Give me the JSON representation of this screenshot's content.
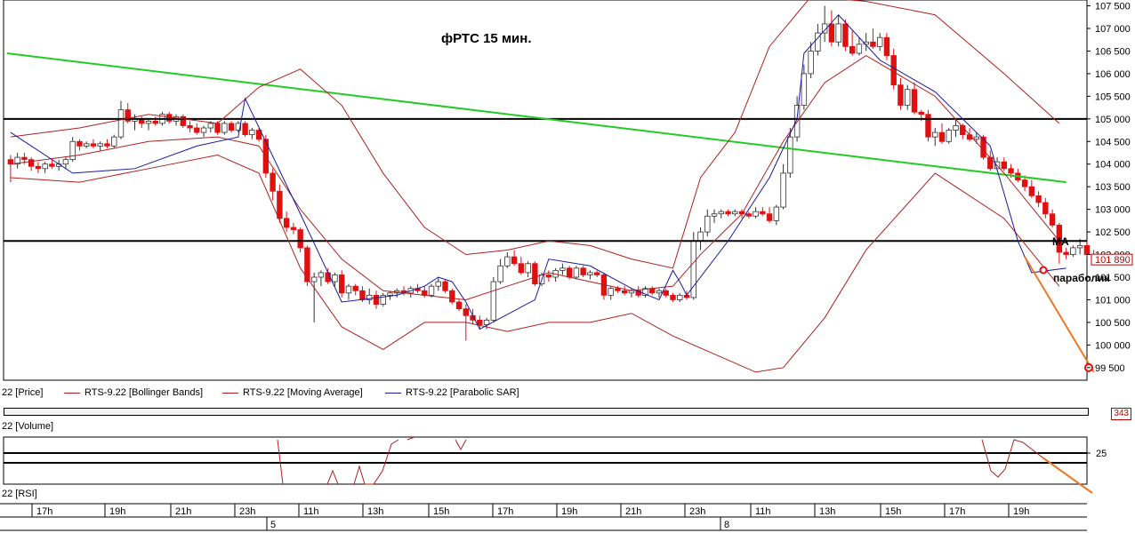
{
  "title": "фРТС   15 мин.",
  "annotations": {
    "ma": "MA",
    "parabolic": "параболик"
  },
  "price_axis": {
    "ticks": [
      "107 500",
      "107 000",
      "106 500",
      "106 000",
      "105 500",
      "105 000",
      "104 500",
      "104 000",
      "103 500",
      "103 000",
      "102 500",
      "102 000",
      "101 500",
      "101 000",
      "100 500",
      "100 000",
      "99 500"
    ],
    "current_price": "101 890",
    "low_marker": "99 500"
  },
  "legend": [
    {
      "label": "22 [Price]",
      "color": ""
    },
    {
      "label": "RTS-9.22 [Bollinger Bands]",
      "color": "#b02020"
    },
    {
      "label": "RTS-9.22 [Moving Average]",
      "color": "#b02020"
    },
    {
      "label": "RTS-9.22 [Parabolic SAR]",
      "color": "#1a1aa0"
    }
  ],
  "volume_pane": {
    "label": "22 [Volume]",
    "badge": "343"
  },
  "rsi_pane": {
    "label": "22 [RSI]",
    "tick": "25"
  },
  "time_axis": {
    "hours": [
      "17h",
      "19h",
      "21h",
      "23h",
      "11h",
      "13h",
      "15h",
      "17h",
      "19h",
      "21h",
      "23h",
      "11h",
      "13h",
      "15h",
      "17h",
      "19h"
    ],
    "days": [
      "5",
      "8"
    ]
  },
  "colors": {
    "up": "#ffffff",
    "down": "#e01010",
    "bollinger": "#b02020",
    "sar": "#1a1aa0",
    "trend": "#22cc22",
    "level": "#000000",
    "forecast": "#ee7722"
  },
  "chart_data": {
    "type": "candlestick",
    "title": "фРТС   15 мин.",
    "ylim": [
      99300,
      107550
    ],
    "levels": [
      105000,
      102300
    ],
    "trendline": [
      [
        0,
        106450
      ],
      [
        153,
        103600
      ]
    ],
    "candles": [
      [
        104100,
        104200,
        103600,
        104000
      ],
      [
        104000,
        104250,
        103900,
        104150
      ],
      [
        104150,
        104250,
        104000,
        104100
      ],
      [
        104100,
        104150,
        103850,
        103950
      ],
      [
        103950,
        104050,
        103800,
        103900
      ],
      [
        103900,
        104050,
        103800,
        104000
      ],
      [
        104000,
        104100,
        103900,
        103950
      ],
      [
        103950,
        104100,
        103850,
        104000
      ],
      [
        104000,
        104150,
        103900,
        104100
      ],
      [
        104100,
        104600,
        104050,
        104500
      ],
      [
        104500,
        104550,
        104300,
        104400
      ],
      [
        104400,
        104500,
        104350,
        104450
      ],
      [
        104450,
        104550,
        104350,
        104400
      ],
      [
        104400,
        104500,
        104300,
        104450
      ],
      [
        104450,
        104550,
        104350,
        104400
      ],
      [
        104400,
        104650,
        104350,
        104600
      ],
      [
        104600,
        105400,
        104550,
        105200
      ],
      [
        105200,
        105350,
        104900,
        104950
      ],
      [
        104950,
        105100,
        104750,
        105000
      ],
      [
        105000,
        105050,
        104800,
        104900
      ],
      [
        104900,
        105000,
        104750,
        104950
      ],
      [
        104950,
        105050,
        104850,
        104900
      ],
      [
        104900,
        105150,
        104850,
        105100
      ],
      [
        105100,
        105150,
        104900,
        104950
      ],
      [
        104950,
        105100,
        104850,
        105050
      ],
      [
        105050,
        105100,
        104800,
        104850
      ],
      [
        104850,
        104950,
        104700,
        104800
      ],
      [
        104800,
        104900,
        104650,
        104700
      ],
      [
        104700,
        104850,
        104600,
        104800
      ],
      [
        104800,
        104950,
        104700,
        104900
      ],
      [
        104900,
        104950,
        104650,
        104700
      ],
      [
        104700,
        104950,
        104650,
        104900
      ],
      [
        104900,
        104950,
        104700,
        104750
      ],
      [
        104750,
        104950,
        104700,
        104900
      ],
      [
        104900,
        104950,
        104600,
        104650
      ],
      [
        104650,
        104800,
        104550,
        104750
      ],
      [
        104750,
        104800,
        104500,
        104550
      ],
      [
        104550,
        104650,
        103700,
        103800
      ],
      [
        103800,
        103900,
        103200,
        103400
      ],
      [
        103400,
        103550,
        102700,
        102800
      ],
      [
        102800,
        102950,
        102500,
        102600
      ],
      [
        102600,
        102700,
        102450,
        102550
      ],
      [
        102550,
        102600,
        102050,
        102150
      ],
      [
        102150,
        102200,
        101300,
        101400
      ],
      [
        101400,
        101600,
        100500,
        101500
      ],
      [
        101500,
        101650,
        101300,
        101600
      ],
      [
        101600,
        101700,
        101350,
        101400
      ],
      [
        101400,
        101600,
        101300,
        101550
      ],
      [
        101550,
        101650,
        101050,
        101150
      ],
      [
        101150,
        101350,
        101000,
        101300
      ],
      [
        101300,
        101350,
        101100,
        101200
      ],
      [
        101200,
        101300,
        100950,
        101000
      ],
      [
        101000,
        101250,
        100900,
        101100
      ],
      [
        101100,
        101200,
        100800,
        100900
      ],
      [
        100900,
        101150,
        100850,
        101100
      ],
      [
        101100,
        101200,
        101000,
        101150
      ],
      [
        101150,
        101250,
        101050,
        101200
      ],
      [
        101200,
        101300,
        101100,
        101150
      ],
      [
        101150,
        101300,
        101050,
        101250
      ],
      [
        101250,
        101350,
        101150,
        101200
      ],
      [
        101200,
        101300,
        101050,
        101100
      ],
      [
        101100,
        101350,
        101050,
        101300
      ],
      [
        101300,
        101500,
        101200,
        101400
      ],
      [
        101400,
        101450,
        101150,
        101200
      ],
      [
        101200,
        101250,
        100900,
        100950
      ],
      [
        100950,
        101000,
        100750,
        100800
      ],
      [
        100800,
        100900,
        100100,
        100650
      ],
      [
        100650,
        100800,
        100450,
        100550
      ],
      [
        100550,
        100650,
        100350,
        100450
      ],
      [
        100450,
        100600,
        100350,
        100550
      ],
      [
        100550,
        101500,
        100500,
        101400
      ],
      [
        101400,
        101900,
        101350,
        101750
      ],
      [
        101750,
        102050,
        101700,
        101950
      ],
      [
        101950,
        102100,
        101750,
        101800
      ],
      [
        101800,
        101950,
        101550,
        101600
      ],
      [
        101600,
        101850,
        101500,
        101800
      ],
      [
        101800,
        101850,
        101300,
        101350
      ],
      [
        101350,
        101600,
        101300,
        101550
      ],
      [
        101550,
        101650,
        101400,
        101500
      ],
      [
        101500,
        101700,
        101400,
        101650
      ],
      [
        101650,
        101800,
        101550,
        101700
      ],
      [
        101700,
        101750,
        101450,
        101500
      ],
      [
        101500,
        101750,
        101450,
        101700
      ],
      [
        101700,
        101750,
        101500,
        101550
      ],
      [
        101550,
        101650,
        101450,
        101600
      ],
      [
        101600,
        101650,
        101500,
        101550
      ],
      [
        101550,
        101600,
        101000,
        101100
      ],
      [
        101100,
        101300,
        101000,
        101250
      ],
      [
        101250,
        101300,
        101150,
        101200
      ],
      [
        101200,
        101300,
        101100,
        101150
      ],
      [
        101150,
        101250,
        101050,
        101200
      ],
      [
        101200,
        101300,
        101050,
        101100
      ],
      [
        101100,
        101300,
        101050,
        101250
      ],
      [
        101250,
        101300,
        101100,
        101150
      ],
      [
        101150,
        101250,
        101050,
        101200
      ],
      [
        101200,
        101250,
        101050,
        101100
      ],
      [
        101100,
        101150,
        100950,
        101000
      ],
      [
        101000,
        101150,
        100950,
        101100
      ],
      [
        101100,
        101200,
        101000,
        101050
      ],
      [
        101050,
        102500,
        101000,
        102300
      ],
      [
        102300,
        102600,
        102100,
        102500
      ],
      [
        102500,
        103000,
        102400,
        102850
      ],
      [
        102850,
        103000,
        102700,
        102900
      ],
      [
        102900,
        103000,
        102800,
        102950
      ],
      [
        102950,
        103000,
        102850,
        102900
      ],
      [
        102900,
        103000,
        102850,
        102950
      ],
      [
        102950,
        103000,
        102800,
        102900
      ],
      [
        102900,
        102950,
        102800,
        102850
      ],
      [
        102850,
        103050,
        102800,
        102950
      ],
      [
        102950,
        103050,
        102850,
        102900
      ],
      [
        102900,
        103050,
        102700,
        102750
      ],
      [
        102750,
        103100,
        102650,
        103050
      ],
      [
        103050,
        104000,
        103000,
        103800
      ],
      [
        103800,
        104800,
        103700,
        104600
      ],
      [
        104600,
        105500,
        104500,
        105300
      ],
      [
        105300,
        106200,
        105200,
        106000
      ],
      [
        106000,
        106700,
        105900,
        106500
      ],
      [
        106500,
        107100,
        106400,
        106900
      ],
      [
        106900,
        107500,
        106700,
        107100
      ],
      [
        107100,
        107400,
        106600,
        106700
      ],
      [
        106700,
        107300,
        106600,
        107100
      ],
      [
        107100,
        107200,
        106500,
        106600
      ],
      [
        106600,
        106950,
        106400,
        106450
      ],
      [
        106450,
        106800,
        106400,
        106650
      ],
      [
        106650,
        106900,
        106500,
        106700
      ],
      [
        106700,
        107000,
        106550,
        106600
      ],
      [
        106600,
        106900,
        106500,
        106800
      ],
      [
        106800,
        106900,
        106300,
        106400
      ],
      [
        106400,
        106550,
        105650,
        105750
      ],
      [
        105750,
        105900,
        105200,
        105300
      ],
      [
        105300,
        105750,
        105200,
        105650
      ],
      [
        105650,
        105800,
        105100,
        105150
      ],
      [
        105150,
        105200,
        104950,
        105100
      ],
      [
        105100,
        105200,
        104500,
        104600
      ],
      [
        104600,
        104800,
        104400,
        104700
      ],
      [
        104700,
        104900,
        104450,
        104500
      ],
      [
        104500,
        104800,
        104450,
        104750
      ],
      [
        104750,
        105000,
        104600,
        104850
      ],
      [
        104850,
        104900,
        104550,
        104650
      ],
      [
        104650,
        104800,
        104500,
        104550
      ],
      [
        104550,
        104700,
        104450,
        104600
      ],
      [
        104600,
        104650,
        104100,
        104150
      ],
      [
        104150,
        104300,
        103850,
        103900
      ],
      [
        103900,
        104150,
        103850,
        104050
      ],
      [
        104050,
        104150,
        103850,
        103900
      ],
      [
        103900,
        104000,
        103700,
        103800
      ],
      [
        103800,
        103900,
        103600,
        103650
      ],
      [
        103650,
        103750,
        103400,
        103500
      ],
      [
        103500,
        103650,
        103250,
        103300
      ],
      [
        103300,
        103400,
        103050,
        103150
      ],
      [
        103150,
        103250,
        102800,
        102900
      ],
      [
        102900,
        103000,
        102600,
        102650
      ],
      [
        102650,
        102700,
        101800,
        102050
      ],
      [
        102050,
        102150,
        101900,
        102000
      ],
      [
        102000,
        102200,
        101950,
        102150
      ],
      [
        102150,
        102350,
        102000,
        102200
      ],
      [
        102200,
        102300,
        101950,
        102000
      ],
      [
        102000,
        102100,
        101850,
        101900
      ]
    ],
    "bollinger_upper": [
      [
        0,
        104600
      ],
      [
        10,
        104800
      ],
      [
        20,
        105100
      ],
      [
        30,
        104900
      ],
      [
        36,
        105700
      ],
      [
        42,
        106100
      ],
      [
        48,
        105300
      ],
      [
        54,
        103800
      ],
      [
        60,
        102600
      ],
      [
        66,
        102000
      ],
      [
        72,
        102100
      ],
      [
        78,
        102300
      ],
      [
        84,
        102200
      ],
      [
        90,
        101900
      ],
      [
        96,
        101700
      ],
      [
        100,
        103700
      ],
      [
        105,
        104700
      ],
      [
        110,
        106600
      ],
      [
        116,
        107700
      ],
      [
        124,
        107600
      ],
      [
        134,
        107300
      ],
      [
        144,
        106000
      ],
      [
        152,
        104900
      ]
    ],
    "bollinger_lower": [
      [
        0,
        103700
      ],
      [
        10,
        103600
      ],
      [
        20,
        103900
      ],
      [
        30,
        104200
      ],
      [
        36,
        103800
      ],
      [
        42,
        101700
      ],
      [
        48,
        100400
      ],
      [
        54,
        99900
      ],
      [
        60,
        100500
      ],
      [
        66,
        100500
      ],
      [
        72,
        100300
      ],
      [
        78,
        100500
      ],
      [
        84,
        100500
      ],
      [
        90,
        100700
      ],
      [
        96,
        100200
      ],
      [
        102,
        99800
      ],
      [
        108,
        99400
      ],
      [
        112,
        99500
      ],
      [
        118,
        100600
      ],
      [
        124,
        102100
      ],
      [
        134,
        103800
      ],
      [
        144,
        102800
      ],
      [
        152,
        101300
      ]
    ],
    "moving_average": [
      [
        0,
        104000
      ],
      [
        10,
        104200
      ],
      [
        20,
        104500
      ],
      [
        30,
        104600
      ],
      [
        36,
        104400
      ],
      [
        42,
        103000
      ],
      [
        48,
        101900
      ],
      [
        54,
        101200
      ],
      [
        60,
        101100
      ],
      [
        66,
        101000
      ],
      [
        72,
        101300
      ],
      [
        78,
        101600
      ],
      [
        84,
        101400
      ],
      [
        90,
        101200
      ],
      [
        96,
        101300
      ],
      [
        100,
        102000
      ],
      [
        106,
        102900
      ],
      [
        112,
        104500
      ],
      [
        118,
        105800
      ],
      [
        124,
        106400
      ],
      [
        134,
        105500
      ],
      [
        144,
        103800
      ],
      [
        152,
        102300
      ]
    ],
    "parabolic_sar": [
      [
        0,
        104700
      ],
      [
        9,
        103800
      ],
      [
        18,
        103900
      ],
      [
        27,
        104400
      ],
      [
        33,
        104600
      ],
      [
        34,
        105450
      ],
      [
        42,
        102900
      ],
      [
        48,
        100950
      ],
      [
        56,
        101100
      ],
      [
        60,
        101300
      ],
      [
        62,
        101500
      ],
      [
        64,
        101400
      ],
      [
        66,
        100950
      ],
      [
        68,
        100350
      ],
      [
        76,
        101000
      ],
      [
        78,
        101900
      ],
      [
        84,
        101750
      ],
      [
        90,
        101250
      ],
      [
        94,
        101000
      ],
      [
        96,
        101650
      ],
      [
        97,
        101400
      ],
      [
        98,
        101100
      ],
      [
        104,
        102300
      ],
      [
        110,
        103700
      ],
      [
        114,
        105000
      ],
      [
        115,
        106450
      ],
      [
        120,
        107300
      ],
      [
        126,
        106300
      ],
      [
        134,
        105600
      ],
      [
        142,
        104400
      ],
      [
        146,
        102300
      ],
      [
        148,
        101600
      ],
      [
        153,
        101700
      ]
    ],
    "forecast": [
      [
        147,
        101950
      ],
      [
        157,
        99400
      ]
    ],
    "rsi_level": 25
  }
}
